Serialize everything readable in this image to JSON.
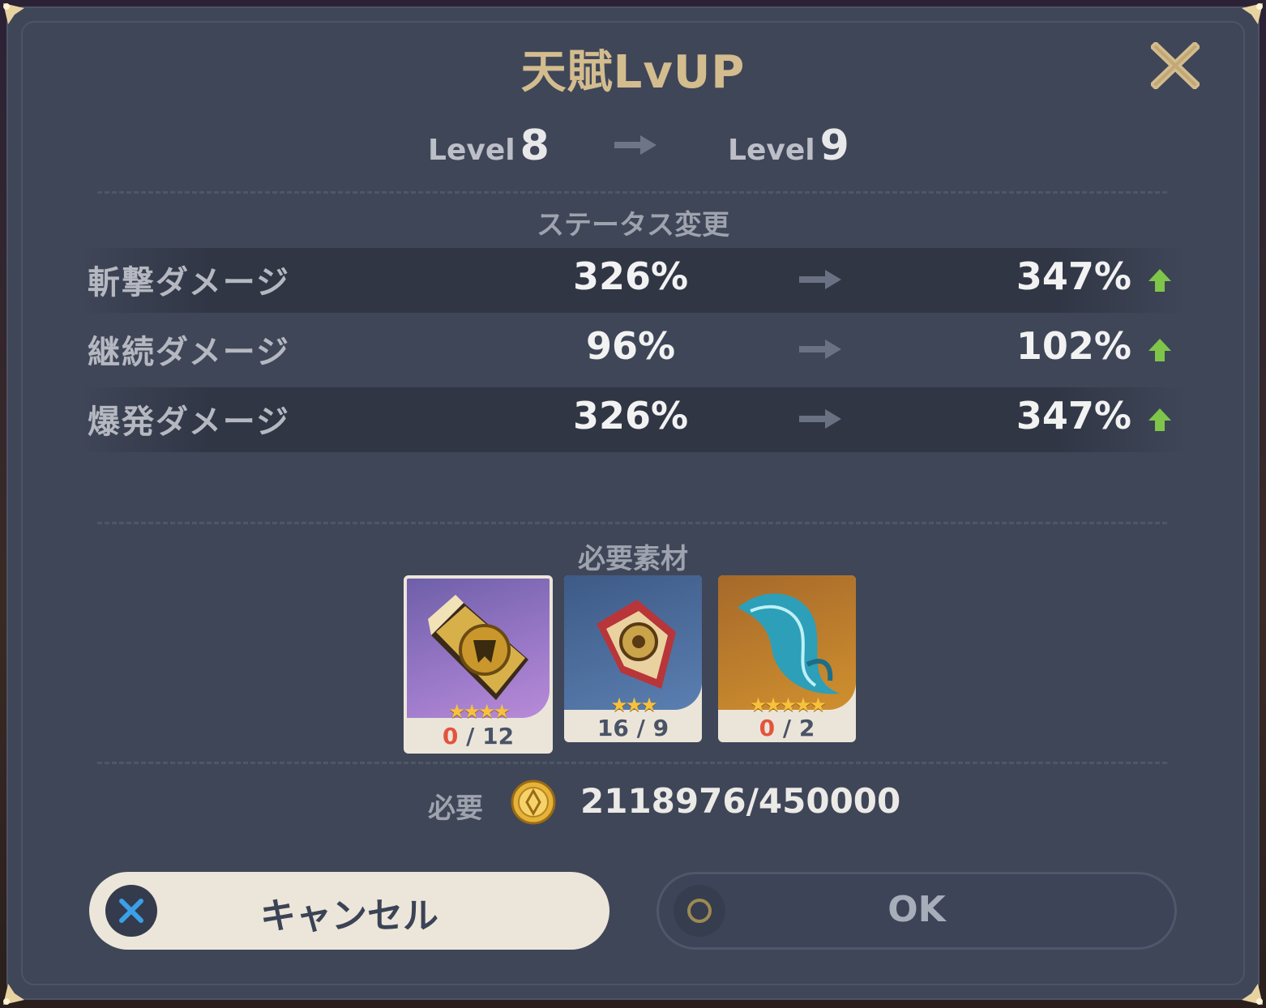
{
  "dialog": {
    "title": "天賦LvUP"
  },
  "level": {
    "from_word": "Level",
    "from_value": "8",
    "to_word": "Level",
    "to_value": "9"
  },
  "status_section": {
    "label": "ステータス変更",
    "rows": [
      {
        "name": "斬撃ダメージ",
        "from": "326%",
        "to": "347%"
      },
      {
        "name": "継続ダメージ",
        "from": "96%",
        "to": "102%"
      },
      {
        "name": "爆発ダメージ",
        "from": "326%",
        "to": "347%"
      }
    ]
  },
  "materials_section": {
    "label": "必要素材",
    "items": [
      {
        "icon": "talent-book-icon",
        "stars": "★★★★",
        "have": "0",
        "need": "/ 12"
      },
      {
        "icon": "monster-drop-icon",
        "stars": "★★★",
        "have": "16",
        "need": "/ 9"
      },
      {
        "icon": "boss-feather-icon",
        "stars": "★★★★★",
        "have": "0",
        "need": "/ 2"
      }
    ]
  },
  "cost": {
    "label": "必要",
    "icon": "mora-coin-icon",
    "amount": "2118976/450000"
  },
  "buttons": {
    "cancel_label": "キャンセル",
    "ok_label": "OK"
  },
  "colors": {
    "title_gold": "#d3bc8e",
    "panel": "#3f4658",
    "up_green": "#7ec54a",
    "insufficient_red": "#e3543d"
  }
}
